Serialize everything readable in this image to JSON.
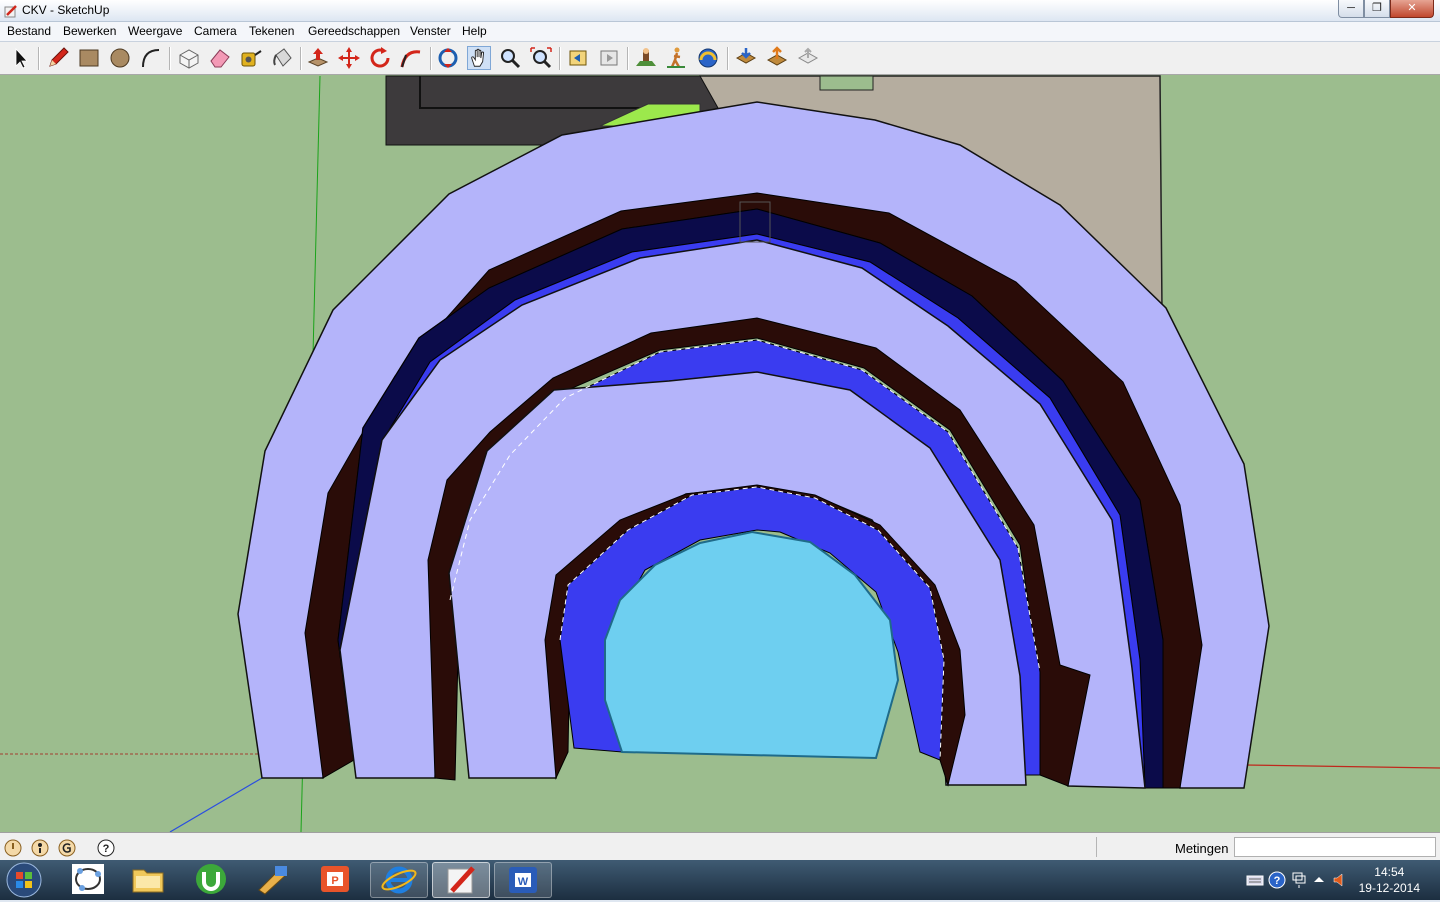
{
  "window": {
    "title": "CKV - SketchUp"
  },
  "menu": [
    "Bestand",
    "Bewerken",
    "Weergave",
    "Camera",
    "Tekenen",
    "Gereedschappen",
    "Venster",
    "Help"
  ],
  "toolbar_tools": [
    "select-tool",
    "pencil-tool",
    "rectangle-tool",
    "circle-tool",
    "arc-tool",
    "make-component-tool",
    "eraser-tool",
    "tape-measure-tool",
    "paint-bucket-tool",
    "push-pull-tool",
    "move-tool",
    "rotate-tool",
    "follow-me-tool",
    "orbit-tool",
    "pan-tool",
    "zoom-tool",
    "zoom-extents-tool",
    "previous-view-tool",
    "next-view-tool",
    "position-camera-tool",
    "walk-tool",
    "look-around-tool",
    "get-models-tool",
    "share-model-tool",
    "share-component-tool"
  ],
  "colors": {
    "ground": "#9cbd8e",
    "arch_outer": "#b4b4fa",
    "arch_dark": "#2a0c08",
    "blue": "#3a3cf0",
    "inner": "#6ecff0",
    "road": "#3d3a3c",
    "building": "#b5ad9f"
  },
  "statusbar": {
    "measurements_label": "Metingen",
    "measurements_value": ""
  },
  "clock": {
    "time": "14:54",
    "date": "19-12-2014"
  }
}
